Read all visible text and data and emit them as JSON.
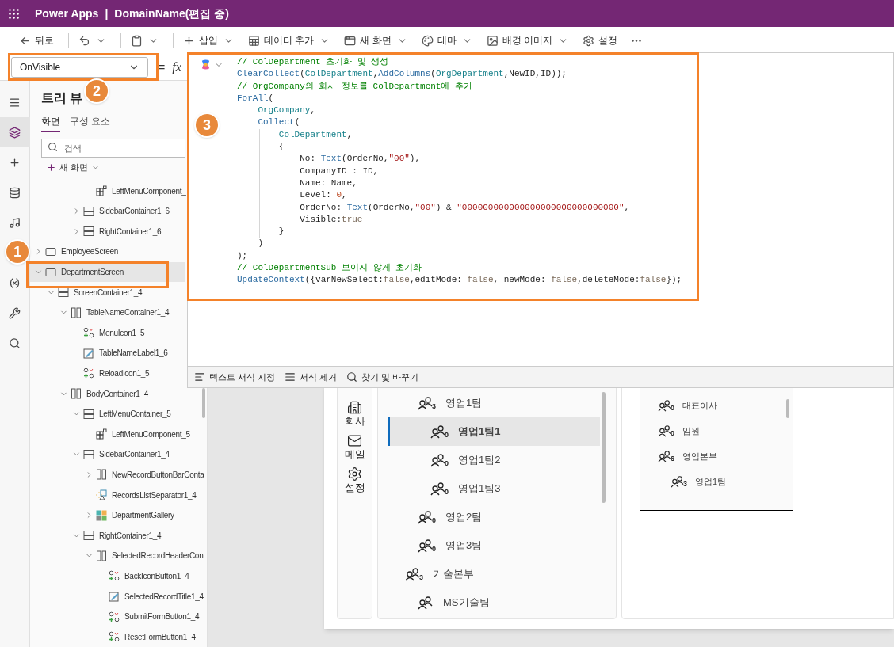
{
  "app_bar": {
    "product": "Power Apps",
    "separator": "|",
    "document": "DomainName(편집 중)"
  },
  "toolbar": [
    {
      "kind": "back",
      "label": "뒤로",
      "dropdown": false
    },
    {
      "kind": "undo",
      "dropdown": true
    },
    {
      "kind": "paste",
      "dropdown": true
    },
    {
      "kind": "insert",
      "label": "삽입",
      "dropdown": true
    },
    {
      "kind": "data",
      "label": "데이터 추가",
      "dropdown": true
    },
    {
      "kind": "screen",
      "label": "새 화면",
      "dropdown": true
    },
    {
      "kind": "theme",
      "label": "테마",
      "dropdown": true
    },
    {
      "kind": "image",
      "label": "배경 이미지",
      "dropdown": true
    },
    {
      "kind": "settings",
      "label": "설정",
      "dropdown": false
    },
    {
      "kind": "more",
      "dropdown": false
    }
  ],
  "formula_bar": {
    "property": "OnVisible",
    "equals": "=",
    "fx": "fx"
  },
  "rail": [
    {
      "kind": "menu",
      "selected": false
    },
    {
      "kind": "tree",
      "selected": true
    },
    {
      "kind": "insert",
      "selected": false
    },
    {
      "kind": "data",
      "selected": false
    },
    {
      "kind": "media",
      "selected": false
    },
    {
      "kind": "variables",
      "selected": false
    },
    {
      "kind": "tools",
      "selected": false
    },
    {
      "kind": "search",
      "selected": false
    }
  ],
  "tree": {
    "title": "트리 뷰",
    "tabs": [
      {
        "label": "화면",
        "selected": true
      },
      {
        "label": "구성 요소",
        "selected": false
      }
    ],
    "search": {
      "placeholder": "검색"
    },
    "new_screen": "새 화면",
    "items": [
      {
        "children": [
          {
            "children": [
              {
                "children": [
                  {
                    "children": [
                      {
                        "label": "LeftMenuComponent_",
                        "kind": "component",
                        "selected": false
                      }
                    ]
                  },
                  {
                    "label": "SidebarContainer1_6",
                    "kind": "vertical",
                    "expanded": false,
                    "selected": false
                  },
                  {
                    "label": "RightContainer1_6",
                    "kind": "vertical",
                    "expanded": false,
                    "selected": false
                  }
                ]
              }
            ]
          }
        ]
      },
      {
        "label": "EmployeeScreen",
        "kind": "screen",
        "expanded": false,
        "selected": false
      },
      {
        "label": "DepartmentScreen",
        "kind": "screen",
        "expanded": true,
        "selected": true,
        "children": [
          {
            "label": "ScreenContainer1_4",
            "kind": "vertical",
            "expanded": true,
            "selected": false,
            "children": [
              {
                "label": "TableNameContainer1_4",
                "kind": "horizontal",
                "expanded": true,
                "selected": false,
                "children": [
                  {
                    "label": "MenuIcon1_5",
                    "kind": "icon",
                    "selected": false
                  },
                  {
                    "label": "TableNameLabel1_6",
                    "kind": "label",
                    "selected": false
                  },
                  {
                    "label": "ReloadIcon1_5",
                    "kind": "icon",
                    "selected": false
                  }
                ]
              },
              {
                "label": "BodyContainer1_4",
                "kind": "horizontal",
                "expanded": true,
                "selected": false,
                "children": [
                  {
                    "label": "LeftMenuContainer_5",
                    "kind": "vertical",
                    "expanded": true,
                    "selected": false,
                    "children": [
                      {
                        "label": "LeftMenuComponent_5",
                        "kind": "component",
                        "selected": false
                      }
                    ]
                  },
                  {
                    "label": "SidebarContainer1_4",
                    "kind": "vertical",
                    "expanded": true,
                    "selected": false,
                    "children": [
                      {
                        "label": "NewRecordButtonBarConta",
                        "kind": "horizontal",
                        "expanded": false,
                        "selected": false
                      },
                      {
                        "label": "RecordsListSeparator1_4",
                        "kind": "separator",
                        "selected": false
                      },
                      {
                        "label": "DepartmentGallery",
                        "kind": "gallery",
                        "expanded": false,
                        "selected": false
                      }
                    ]
                  },
                  {
                    "label": "RightContainer1_4",
                    "kind": "vertical",
                    "expanded": true,
                    "selected": false,
                    "children": [
                      {
                        "label": "SelectedRecordHeaderCon",
                        "kind": "horizontal",
                        "expanded": true,
                        "selected": false,
                        "children": [
                          {
                            "label": "BackIconButton1_4",
                            "kind": "icon",
                            "selected": false
                          },
                          {
                            "label": "SelectedRecordTitle1_4",
                            "kind": "label",
                            "selected": false
                          },
                          {
                            "label": "SubmitFormButton1_4",
                            "kind": "icon",
                            "selected": false
                          },
                          {
                            "label": "ResetFormButton1_4",
                            "kind": "icon",
                            "selected": false
                          }
                        ]
                      }
                    ]
                  }
                ]
              }
            ]
          }
        ]
      }
    ]
  },
  "code": [
    [
      {
        "kind": "comment",
        "s": "// ColDepartment 초기화 및 생성"
      }
    ],
    [
      {
        "kind": "function",
        "s": "ClearCollect"
      },
      {
        "kind": "plain",
        "s": "("
      },
      {
        "kind": "ident",
        "s": "ColDepartment"
      },
      {
        "kind": "plain",
        "s": ","
      },
      {
        "kind": "function",
        "s": "AddColumns"
      },
      {
        "kind": "plain",
        "s": "("
      },
      {
        "kind": "ident",
        "s": "OrgDepartment"
      },
      {
        "kind": "plain",
        "s": ",NewID,ID));"
      }
    ],
    [
      {
        "kind": "comment",
        "s": "// OrgCompany의 회사 정보를 ColDepartment에 추가"
      }
    ],
    [
      {
        "kind": "function",
        "s": "ForAll"
      },
      {
        "kind": "plain",
        "s": "("
      }
    ],
    [
      {
        "kind": "ident",
        "s": "    OrgCompany"
      },
      {
        "kind": "plain",
        "s": ","
      }
    ],
    [
      {
        "kind": "function",
        "s": "    Collect"
      },
      {
        "kind": "plain",
        "s": "("
      }
    ],
    [
      {
        "kind": "ident",
        "s": "        ColDepartment"
      },
      {
        "kind": "plain",
        "s": ","
      }
    ],
    [
      {
        "kind": "plain",
        "s": "        {"
      }
    ],
    [
      {
        "kind": "plain",
        "s": "            No: "
      },
      {
        "kind": "function",
        "s": "Text"
      },
      {
        "kind": "plain",
        "s": "(OrderNo,"
      },
      {
        "kind": "string",
        "s": "\"00\""
      },
      {
        "kind": "plain",
        "s": "),"
      }
    ],
    [
      {
        "kind": "plain",
        "s": "            CompanyID : ID,"
      }
    ],
    [
      {
        "kind": "plain",
        "s": "            Name: Name,"
      }
    ],
    [
      {
        "kind": "plain",
        "s": "            Level: "
      },
      {
        "kind": "number",
        "s": "0"
      },
      {
        "kind": "plain",
        "s": ","
      }
    ],
    [
      {
        "kind": "plain",
        "s": "            OrderNo: "
      },
      {
        "kind": "function",
        "s": "Text"
      },
      {
        "kind": "plain",
        "s": "(OrderNo,"
      },
      {
        "kind": "string",
        "s": "\"00\""
      },
      {
        "kind": "plain",
        "s": ") & "
      },
      {
        "kind": "string",
        "s": "\"000000000000000000000000000000\""
      },
      {
        "kind": "plain",
        "s": ","
      }
    ],
    [
      {
        "kind": "plain",
        "s": "            Visible:"
      },
      {
        "kind": "bool",
        "s": "true"
      }
    ],
    [
      {
        "kind": "plain",
        "s": "        }"
      }
    ],
    [
      {
        "kind": "plain",
        "s": "    )"
      }
    ],
    [
      {
        "kind": "plain",
        "s": ");"
      }
    ],
    [
      {
        "kind": "comment",
        "s": "// ColDepartmentSub 보이지 않게 초기화"
      }
    ],
    [
      {
        "kind": "function",
        "s": "UpdateContext"
      },
      {
        "kind": "plain",
        "s": "({varNewSelect:"
      },
      {
        "kind": "bool",
        "s": "false"
      },
      {
        "kind": "plain",
        "s": ",editMode: "
      },
      {
        "kind": "bool",
        "s": "false"
      },
      {
        "kind": "plain",
        "s": ", newMode: "
      },
      {
        "kind": "bool",
        "s": "false"
      },
      {
        "kind": "plain",
        "s": ",deleteMode:"
      },
      {
        "kind": "bool",
        "s": "false"
      },
      {
        "kind": "plain",
        "s": "});"
      }
    ]
  ],
  "format_bar": [
    {
      "kind": "format",
      "label": "텍스트 서식 지정"
    },
    {
      "kind": "clear",
      "label": "서식 제거"
    },
    {
      "kind": "find",
      "label": "찾기 및 바꾸기"
    }
  ],
  "app_nav": [
    {
      "kind": "building",
      "label": "회사"
    },
    {
      "kind": "mail",
      "label": "메일"
    },
    {
      "kind": "settings",
      "label": "설정"
    }
  ],
  "gallery": {
    "items": [
      {
        "children": [
          {
            "label": "영업1팀",
            "count": "3",
            "selected": false,
            "children": [
              {
                "label": "영업1팀1",
                "count": "0",
                "selected": true
              },
              {
                "label": "영업1팀2",
                "count": "0",
                "selected": false
              },
              {
                "label": "영업1팀3",
                "count": "0",
                "selected": false
              }
            ]
          },
          {
            "label": "영업2팀",
            "count": "0",
            "selected": false
          },
          {
            "label": "영업3팀",
            "count": "0",
            "selected": false
          }
        ]
      },
      {
        "label": "기술본부",
        "count": "3",
        "selected": false,
        "children": [
          {
            "label": "MS기술팀",
            "selected": false
          }
        ]
      }
    ]
  },
  "org_box": {
    "items": [
      {
        "label": "대표이사",
        "count": "0"
      },
      {
        "label": "임원",
        "count": "0"
      },
      {
        "label": "영업본부",
        "count": "6",
        "children": [
          {
            "label": "영업1팀",
            "count": "3"
          }
        ]
      }
    ]
  },
  "callouts": [
    {
      "number": "1"
    },
    {
      "number": "2"
    },
    {
      "number": "3"
    }
  ]
}
